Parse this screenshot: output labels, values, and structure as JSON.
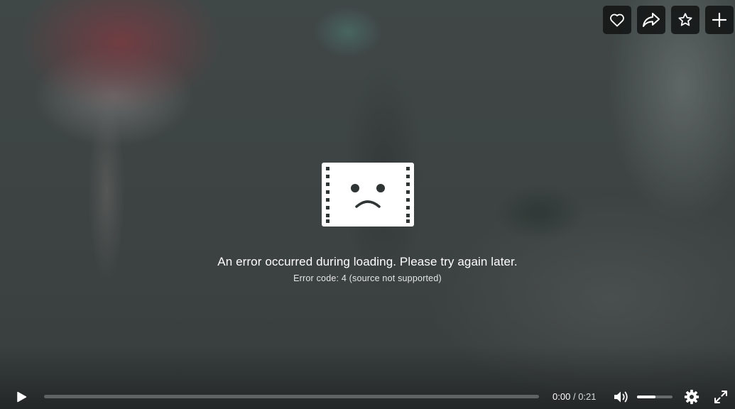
{
  "player": {
    "error": {
      "message": "An error occurred during loading. Please try again later.",
      "code": "Error code: 4 (source not supported)",
      "icon": "sad-film-icon"
    },
    "actions": [
      {
        "name": "like",
        "icon": "heart-icon"
      },
      {
        "name": "share",
        "icon": "share-arrow-icon"
      },
      {
        "name": "watch-later",
        "icon": "star-icon"
      },
      {
        "name": "add-to-collection",
        "icon": "plus-icon"
      }
    ],
    "controls": {
      "current_time": "0:00",
      "separator": "/",
      "duration": "0:21",
      "progress_fraction": 0,
      "volume_fraction": 0.52,
      "icons": [
        "play-icon",
        "volume-icon",
        "gear-icon",
        "fullscreen-icon"
      ]
    }
  },
  "colors": {
    "overlay_button_bg": "#171919",
    "text": "#ffffff"
  }
}
